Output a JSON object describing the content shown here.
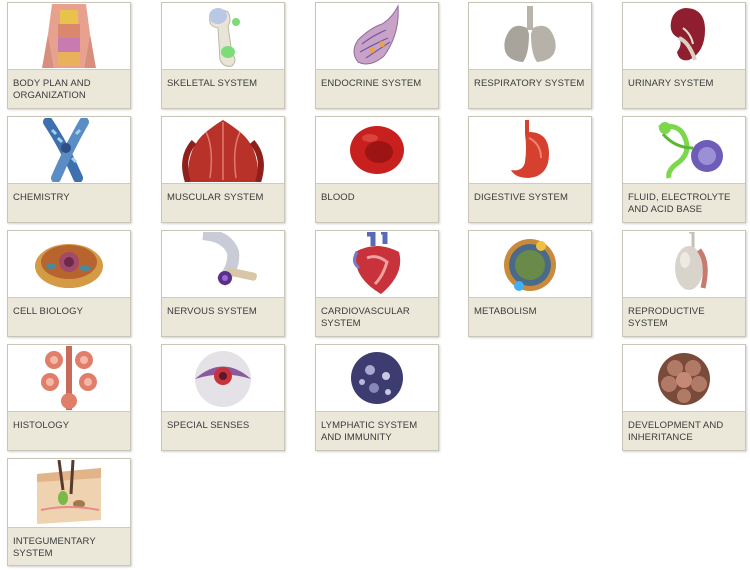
{
  "tiles": [
    {
      "label": "BODY PLAN AND ORGANIZATION",
      "icon": "torso-icon"
    },
    {
      "label": "SKELETAL SYSTEM",
      "icon": "bone-icon"
    },
    {
      "label": "ENDOCRINE SYSTEM",
      "icon": "gland-icon"
    },
    {
      "label": "RESPIRATORY SYSTEM",
      "icon": "lungs-icon"
    },
    {
      "label": "URINARY SYSTEM",
      "icon": "kidney-icon"
    },
    {
      "label": "CHEMISTRY",
      "icon": "chromosome-icon"
    },
    {
      "label": "MUSCULAR SYSTEM",
      "icon": "muscle-icon"
    },
    {
      "label": "BLOOD",
      "icon": "red-blood-cell-icon"
    },
    {
      "label": "DIGESTIVE SYSTEM",
      "icon": "stomach-icon"
    },
    {
      "label": "FLUID, ELECTROLYTE AND ACID BASE",
      "icon": "nephron-icon"
    },
    {
      "label": "CELL BIOLOGY",
      "icon": "cell-icon"
    },
    {
      "label": "NERVOUS SYSTEM",
      "icon": "neuron-icon"
    },
    {
      "label": "CARDIOVASCULAR SYSTEM",
      "icon": "heart-icon"
    },
    {
      "label": "METABOLISM",
      "icon": "metabolism-cell-icon"
    },
    {
      "label": "REPRODUCTIVE SYSTEM",
      "icon": "testis-icon"
    },
    {
      "label": "HISTOLOGY",
      "icon": "tissue-gland-icon"
    },
    {
      "label": "SPECIAL SENSES",
      "icon": "eye-icon"
    },
    {
      "label": "LYMPHATIC SYSTEM AND IMMUNITY",
      "icon": "lymphocyte-icon"
    },
    {
      "label": "DEVELOPMENT AND INHERITANCE",
      "icon": "morula-icon"
    },
    {
      "label": "INTEGUMENTARY SYSTEM",
      "icon": "skin-icon"
    }
  ]
}
